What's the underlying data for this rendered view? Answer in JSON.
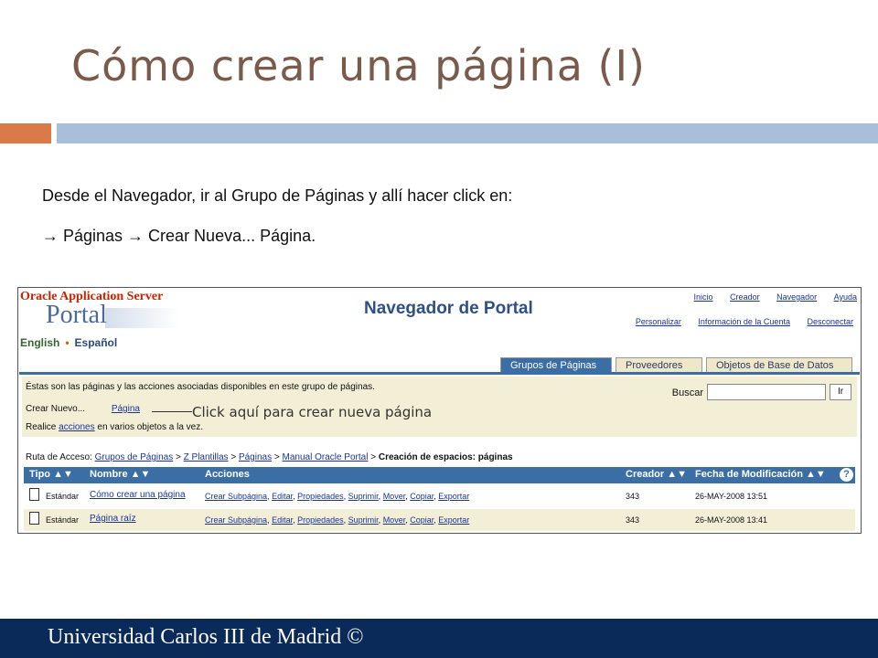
{
  "slide": {
    "title": "Cómo crear una página (I)",
    "instruction_1": "Desde el Navegador, ir al Grupo de Páginas y allí hacer click en:",
    "instruction_2": "→ Páginas → Crear Nueva... Página.",
    "footer": "Universidad Carlos III de Madrid ©",
    "colors": {
      "title": "#7a5a4a",
      "accent_orange": "#d97a48",
      "accent_blue": "#a8bfdc",
      "footer_bg": "#0a2a5a"
    }
  },
  "portal": {
    "brand_top": "Oracle Application Server",
    "brand_portal": "Portal",
    "lang_english": "English",
    "lang_spanish": "Español",
    "page_title": "Navegador de Portal",
    "top_links": [
      "Inicio",
      "Creador",
      "Navegador",
      "Ayuda"
    ],
    "sub_links": [
      "Personalizar",
      "Información de la Cuenta",
      "Desconectar"
    ],
    "tabs": [
      {
        "label": "Grupos de Páginas",
        "active": true
      },
      {
        "label": "Proveedores",
        "active": false
      },
      {
        "label": "Objetos de Base de Datos",
        "active": false
      }
    ],
    "intro_text": "Éstas son las páginas y las acciones asociadas disponibles en este grupo de páginas.",
    "create_new_label": "Crear Nuevo...",
    "create_new_link": "Página",
    "click_annotation": "Click aquí para crear nueva página",
    "realice_prefix": "Realice",
    "realice_link": "acciones",
    "realice_suffix": "en varios objetos a la vez.",
    "search_label": "Buscar",
    "search_value": "",
    "search_button": "Ir",
    "breadcrumb": {
      "prefix": "Ruta de Acceso:",
      "items": [
        "Grupos de Páginas",
        "Z Plantillas",
        "Páginas",
        "Manual Oracle Portal"
      ],
      "separator": ">",
      "current": "Creación de espacios: páginas"
    },
    "table": {
      "headers": {
        "tipo": "Tipo ▲▼",
        "nombre": "Nombre ▲▼",
        "acciones": "Acciones",
        "creador": "Creador ▲▼",
        "fecha": "Fecha de Modificación ▲▼"
      },
      "help_icon": "?",
      "rows": [
        {
          "tipo": "Estándar",
          "nombre": "Cómo crear una página",
          "acciones": [
            "Crear Subpágina",
            "Editar",
            "Propiedades",
            "Suprimir",
            "Mover",
            "Copiar",
            "Exportar"
          ],
          "creador": "343",
          "fecha": "26-MAY-2008 13:51"
        },
        {
          "tipo": "Estándar",
          "nombre": "Página raíz",
          "acciones": [
            "Crear Subpágina",
            "Editar",
            "Propiedades",
            "Suprimir",
            "Mover",
            "Copiar",
            "Exportar"
          ],
          "creador": "343",
          "fecha": "26-MAY-2008 13:41"
        }
      ]
    }
  }
}
